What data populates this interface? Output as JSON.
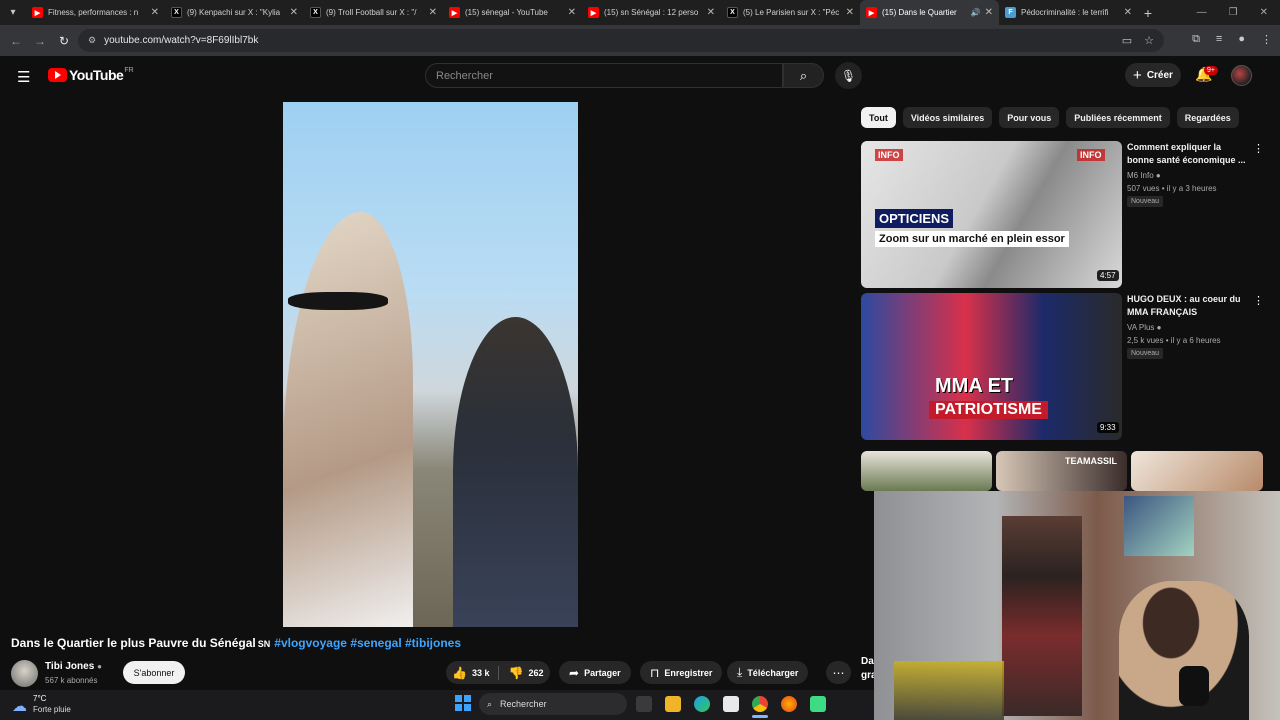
{
  "browser": {
    "tabs": [
      {
        "title": "Fitness, performances : n",
        "favicon": "youtube-icon"
      },
      {
        "title": "(9) Kenpachi sur X : \"Kylia",
        "favicon": "x-icon"
      },
      {
        "title": "(9) Troll Football sur X : \"/",
        "favicon": "x-icon"
      },
      {
        "title": "(15) sénegal - YouTube",
        "favicon": "youtube-icon"
      },
      {
        "title": "(15) sn Sénégal : 12 perso",
        "favicon": "youtube-icon"
      },
      {
        "title": "(5) Le Parisien sur X : \"Péc",
        "favicon": "x-icon"
      },
      {
        "title": "(15) Dans le Quartier",
        "favicon": "youtube-icon",
        "active": true
      },
      {
        "title": "Pédocriminalité : le terrifi",
        "favicon": "article-icon"
      }
    ],
    "url": "youtube.com/watch?v=8F69lIbl7bk"
  },
  "masthead": {
    "logo_text": "YouTube",
    "country_code": "FR",
    "search_placeholder": "Rechercher",
    "create_label": "Créer",
    "notifications_badge": "9+"
  },
  "video": {
    "title": "Dans le Quartier le plus Pauvre du Sénégal",
    "flag": "SN",
    "hashtags": "#vlogvoyage #senegal #tibijones",
    "channel": "Tibi Jones",
    "subscribers": "567 k abonnés",
    "subscribe_label": "S'abonner",
    "likes": "33 k",
    "dislikes": "262",
    "share_label": "Partager",
    "save_label": "Enregistrer",
    "download_label": "Télécharger"
  },
  "chips": [
    "Tout",
    "Vidéos similaires",
    "Pour vous",
    "Publiées récemment",
    "Regardées"
  ],
  "recommendations": [
    {
      "title": "Comment expliquer la bonne santé économique ...",
      "channel": "M6 Info",
      "meta": "507 vues • il y a 3 heures",
      "badge": "Nouveau",
      "duration": "4:57",
      "thumb_line1": "OPTICIENS",
      "thumb_line2": "Zoom sur un marché en plein essor",
      "thumb_logo": "INFO"
    },
    {
      "title": "HUGO DEUX : au coeur du MMA FRANÇAIS",
      "channel": "VA Plus",
      "meta": "2,5 k vues • il y a 6 heures",
      "badge": "Nouveau",
      "duration": "9:33",
      "thumb_line1": "MMA ET",
      "thumb_line2": "PATRIOTISME"
    }
  ],
  "row3_label": "TEAMASSIL",
  "peek_text": "Da\ngra",
  "taskbar": {
    "temperature": "7°C",
    "weather": "Forte pluie",
    "search_label": "Rechercher"
  },
  "colors": {
    "background": "#0f0f0f",
    "youtube_red": "#ff0000",
    "link_blue": "#3ea6ff",
    "chip_bg": "#272727"
  }
}
